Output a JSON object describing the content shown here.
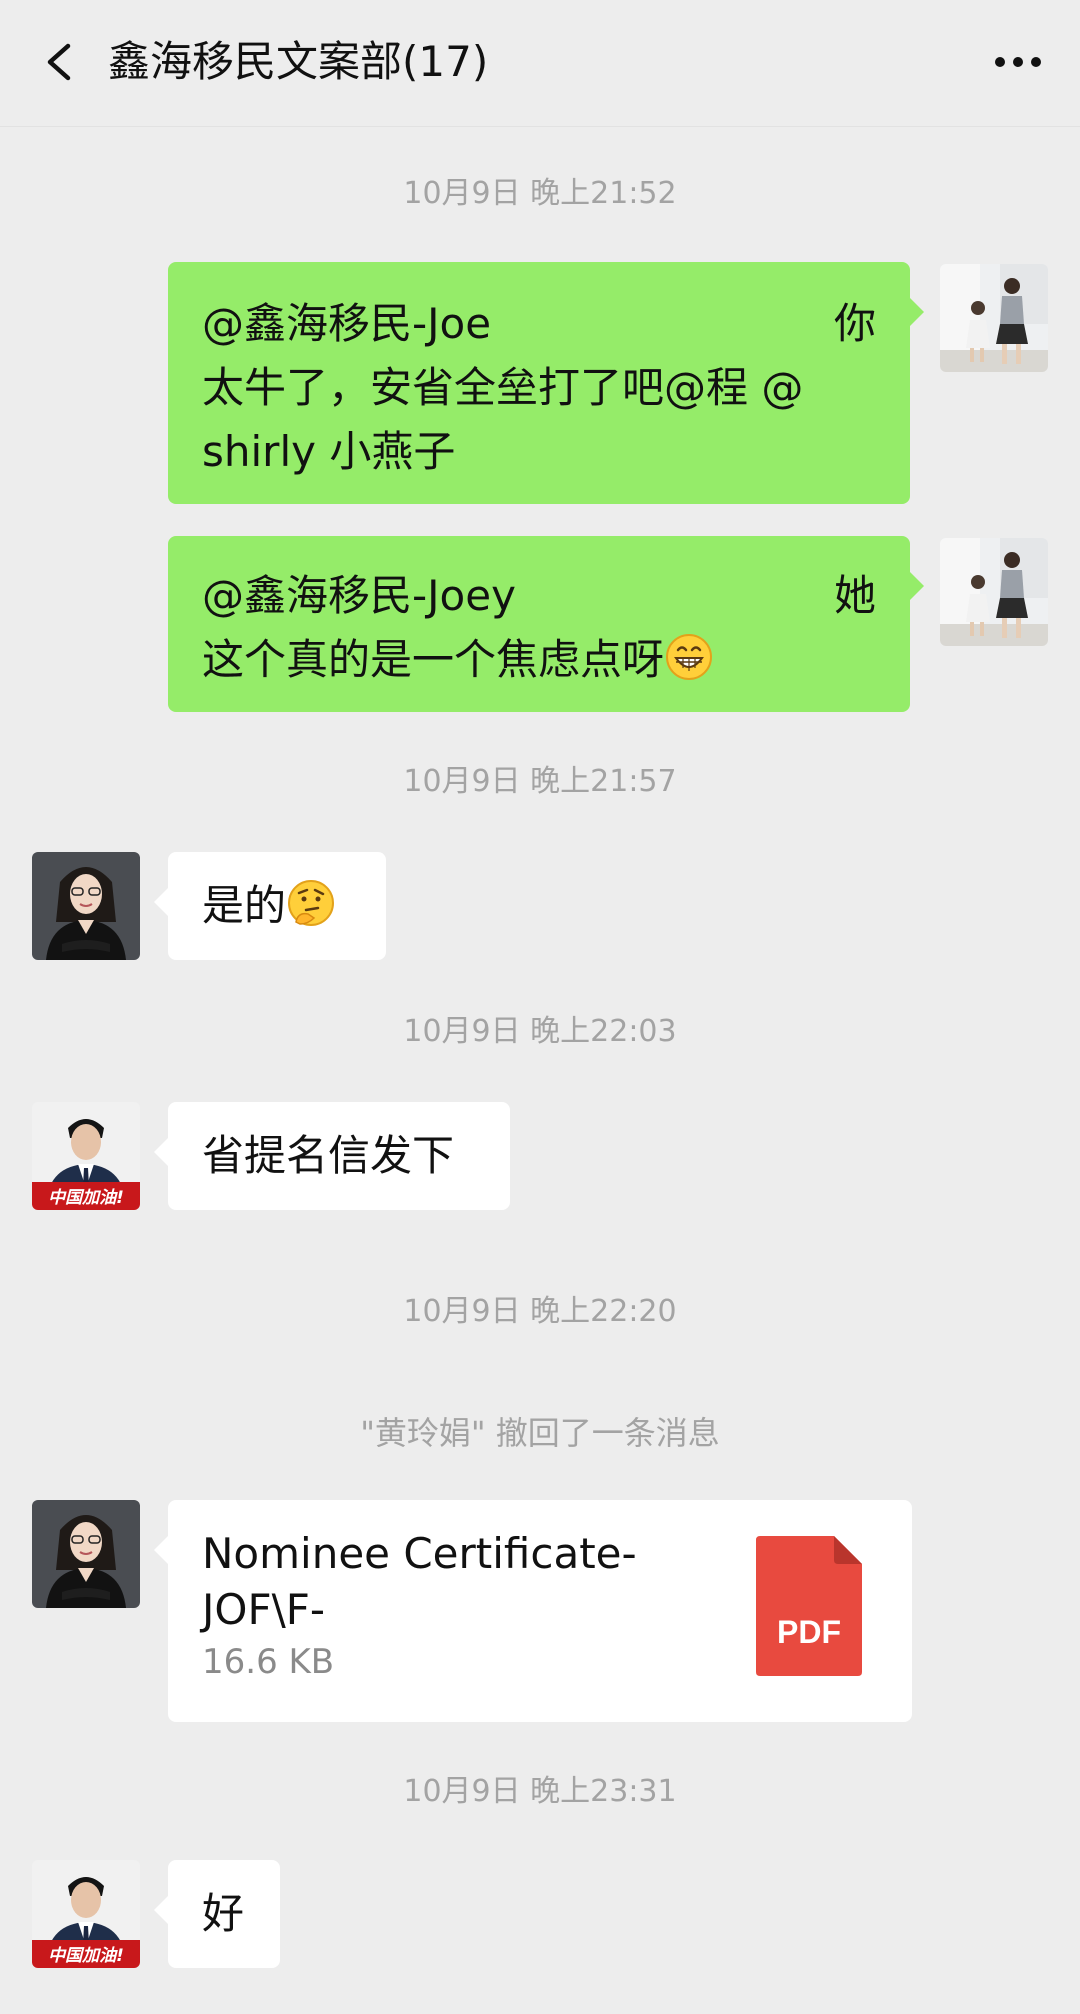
{
  "header": {
    "title": "鑫海移民文案部(17)",
    "back_icon": "chevron-left-icon",
    "more_icon": "more-icon"
  },
  "timestamps": [
    "10月9日 晚上21:52",
    "10月9日 晚上21:57",
    "10月9日 晚上22:03",
    "10月9日 晚上22:20",
    "10月9日 晚上23:31"
  ],
  "messages": [
    {
      "direction": "out",
      "lines": [
        {
          "left": "@鑫海移民-Joe",
          "right": "你"
        },
        {
          "left": "太牛了，安省全垒打了吧@程  @"
        },
        {
          "left": "shirly 小燕子"
        }
      ]
    },
    {
      "direction": "out",
      "lines": [
        {
          "left": "@鑫海移民-Joey",
          "right": "她"
        },
        {
          "left": "这个真的是一个焦虑点呀",
          "emoji": "grinning-face-emoji"
        }
      ]
    },
    {
      "direction": "in",
      "text": "是的",
      "emoji": "thinking-face-emoji"
    },
    {
      "direction": "in",
      "text": "省提名信发下"
    },
    {
      "direction": "in",
      "type": "file",
      "file_name_line1": "Nominee Certificate-",
      "file_name_line2": "JOF\\F-",
      "file_size": "16.6 KB",
      "file_type": "PDF"
    },
    {
      "direction": "in",
      "text": "好"
    }
  ],
  "system_note": "\"黄玲娟\" 撤回了一条消息",
  "colors": {
    "background": "#ededed",
    "outgoing_bubble": "#95ec69",
    "incoming_bubble": "#ffffff",
    "timestamp_text": "#a3a3a3",
    "pdf_red": "#e84a3f"
  }
}
